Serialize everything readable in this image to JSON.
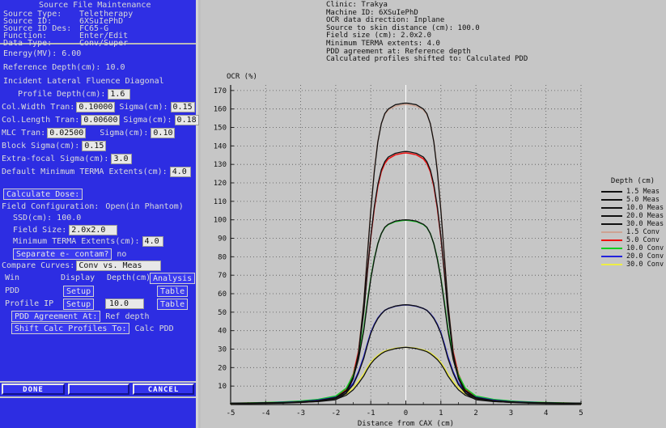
{
  "window": {
    "title": "Source File Maintenance",
    "header_fields": [
      {
        "label": "Source Type:",
        "value": "Teletherapy"
      },
      {
        "label": "Source ID:",
        "value": "6XSuIePhD"
      },
      {
        "label": "Source ID Des:",
        "value": "FC65-G"
      },
      {
        "label": "Function:",
        "value": "Enter/Edit"
      },
      {
        "label": "Data Type:",
        "value": "Conv/Super"
      }
    ]
  },
  "form": {
    "energy_label": "Energy(MV): 6.00",
    "reference_depth_label": "Reference Depth(cm): 10.0",
    "section_title": "Incident Lateral Fluence Diagonal",
    "profile_depth_label": "Profile Depth(cm):",
    "profile_depth_value": "1.6",
    "col_width_label": "Col.Width Tran:",
    "col_width_value": "0.10000",
    "col_width_sigma_label": "Sigma(cm):",
    "col_width_sigma_value": "0.15",
    "col_length_label": "Col.Length Tran:",
    "col_length_value": "0.00600",
    "col_length_sigma_label": "Sigma(cm):",
    "col_length_sigma_value": "0.18",
    "mlc_label": "MLC Tran:",
    "mlc_value": "0.02500",
    "mlc_sigma_label": "Sigma(cm):",
    "mlc_sigma_value": "0.10",
    "block_sigma_label": "Block Sigma(cm):",
    "block_sigma_value": "0.15",
    "extra_focal_label": "Extra-focal Sigma(cm):",
    "extra_focal_value": "3.0",
    "default_terma_label": "Default Minimum TERMA Extents(cm):",
    "default_terma_value": "4.0",
    "calculate_dose_button": "Calculate Dose:",
    "field_config_label": "Field Configuration:",
    "field_config_value": "Open(in Phantom)",
    "ssd_label": "SSD(cm): 100.0",
    "field_size_label": "Field Size:",
    "field_size_value": "2.0x2.0",
    "min_terma_label": "Minimum TERMA Extents(cm):",
    "min_terma_value": "4.0",
    "separate_contam_button": "Separate e- contam?",
    "separate_contam_value": "no",
    "compare_curves_label": "Compare Curves:",
    "compare_curves_value": "Conv vs. Meas",
    "table_headers": {
      "win": "Win",
      "display": "Display",
      "depth": "Depth(cm)",
      "analysis": "Analysis"
    },
    "rows": [
      {
        "win": "PDD",
        "setup": "Setup",
        "depth": "",
        "table": "Table"
      },
      {
        "win": "Profile IP",
        "setup": "Setup",
        "depth": "10.0",
        "table": "Table"
      }
    ],
    "pdd_agreement_button": "PDD Agreement At:",
    "pdd_agreement_value": "Ref depth",
    "shift_calc_button": "Shift Calc Profiles To:",
    "shift_calc_value": "Calc PDD"
  },
  "buttons": {
    "done": "DONE",
    "cancel": "CANCEL"
  },
  "plot_info": [
    "Clinic: Trakya",
    "Machine ID: 6XSuIePhD",
    "OCR data direction: Inplane",
    "Source to skin distance (cm): 100.0",
    "Field size (cm): 2.0x2.0",
    "Minimum TERMA extents: 4.0",
    "PDD agreement at: Reference depth",
    "Calculated profiles shifted to: Calculated PDD"
  ],
  "colors": {
    "meas": "#101010",
    "conv_1_5": "#cda393",
    "conv_5_0": "#ee1111",
    "conv_10_0": "#11cc22",
    "conv_20_0": "#2222dd",
    "conv_30_0": "#eeee44",
    "panel_bg": "#2d2de2",
    "chart_bg": "#c6c6c6"
  },
  "chart_data": {
    "type": "line",
    "title": "",
    "xlabel": "Distance from CAX (cm)",
    "ylabel": "OCR (%)",
    "xlim": [
      -5,
      5
    ],
    "ylim": [
      0,
      173
    ],
    "xticks": [
      -5,
      -4,
      -3,
      -2,
      -1,
      0,
      1,
      2,
      3,
      4,
      5
    ],
    "yticks": [
      10,
      20,
      30,
      40,
      50,
      60,
      70,
      80,
      90,
      100,
      110,
      120,
      130,
      140,
      150,
      160,
      170
    ],
    "grid": true,
    "legend_title": "Depth (cm)",
    "legend_position": "right",
    "x": [
      -5.0,
      -4.5,
      -4.0,
      -3.5,
      -3.0,
      -2.5,
      -2.0,
      -1.7,
      -1.5,
      -1.35,
      -1.2,
      -1.1,
      -1.0,
      -0.9,
      -0.8,
      -0.7,
      -0.6,
      -0.5,
      -0.3,
      -0.1,
      0.0,
      0.1,
      0.3,
      0.5,
      0.6,
      0.7,
      0.8,
      0.9,
      1.0,
      1.1,
      1.2,
      1.35,
      1.5,
      1.7,
      2.0,
      2.5,
      3.0,
      3.5,
      4.0,
      4.5,
      5.0
    ],
    "series": [
      {
        "name": "1.5 Meas",
        "color": "#101010",
        "depth": 1.5,
        "kind": "meas",
        "values": [
          0.7,
          0.8,
          0.9,
          1.0,
          1.2,
          1.6,
          2.6,
          6.0,
          14.0,
          28.0,
          55.0,
          80.0,
          105.0,
          126.0,
          142.0,
          152.0,
          157.5,
          160.0,
          162.3,
          163.0,
          163.2,
          163.0,
          162.3,
          160.0,
          157.5,
          152.0,
          142.0,
          126.0,
          105.0,
          80.0,
          55.0,
          28.0,
          14.0,
          6.0,
          2.6,
          1.6,
          1.2,
          1.0,
          0.9,
          0.8,
          0.7
        ]
      },
      {
        "name": "5.0 Meas",
        "color": "#101010",
        "depth": 5.0,
        "kind": "meas",
        "values": [
          0.7,
          0.8,
          0.9,
          1.1,
          1.4,
          2.0,
          3.4,
          7.2,
          15.0,
          27.0,
          50.0,
          71.0,
          91.0,
          107.0,
          119.0,
          127.0,
          131.5,
          134.0,
          136.0,
          136.8,
          137.0,
          136.8,
          136.0,
          134.0,
          131.5,
          127.0,
          119.0,
          107.0,
          91.0,
          71.0,
          50.0,
          27.0,
          15.0,
          7.2,
          3.4,
          2.0,
          1.4,
          1.1,
          0.9,
          0.8,
          0.7
        ]
      },
      {
        "name": "10.0 Meas",
        "color": "#101010",
        "depth": 10.0,
        "kind": "meas",
        "values": [
          0.6,
          0.7,
          0.9,
          1.1,
          1.5,
          2.2,
          3.8,
          7.6,
          14.5,
          24.5,
          40.0,
          54.5,
          68.0,
          78.5,
          87.0,
          92.5,
          96.0,
          97.6,
          99.3,
          99.9,
          100.0,
          99.9,
          99.3,
          97.6,
          96.0,
          92.5,
          87.0,
          78.5,
          68.0,
          54.5,
          40.0,
          24.5,
          14.5,
          7.6,
          3.8,
          2.2,
          1.5,
          1.1,
          0.9,
          0.7,
          0.6
        ]
      },
      {
        "name": "20.0 Meas",
        "color": "#101010",
        "depth": 20.0,
        "kind": "meas",
        "values": [
          0.5,
          0.6,
          0.7,
          0.9,
          1.3,
          2.0,
          3.4,
          6.2,
          10.8,
          17.0,
          25.0,
          32.0,
          38.5,
          43.0,
          46.5,
          49.0,
          51.0,
          52.0,
          53.3,
          53.9,
          54.0,
          53.9,
          53.3,
          52.0,
          51.0,
          49.0,
          46.5,
          43.0,
          38.5,
          32.0,
          25.0,
          17.0,
          10.8,
          6.2,
          3.4,
          2.0,
          1.3,
          0.9,
          0.7,
          0.6,
          0.5
        ]
      },
      {
        "name": "30.0 Meas",
        "color": "#101010",
        "depth": 30.0,
        "kind": "meas",
        "values": [
          0.4,
          0.5,
          0.6,
          0.8,
          1.1,
          1.7,
          2.8,
          5.0,
          8.0,
          11.5,
          15.5,
          19.0,
          22.0,
          24.3,
          26.0,
          27.5,
          28.6,
          29.3,
          30.3,
          30.8,
          31.0,
          30.8,
          30.3,
          29.3,
          28.6,
          27.5,
          26.0,
          24.3,
          22.0,
          19.0,
          15.5,
          11.5,
          8.0,
          5.0,
          2.8,
          1.7,
          1.1,
          0.8,
          0.6,
          0.5,
          0.4
        ]
      },
      {
        "name": "1.5 Conv",
        "color": "#cda393",
        "depth": 1.5,
        "kind": "conv",
        "values": [
          0.6,
          0.7,
          0.8,
          1.0,
          1.2,
          1.7,
          3.0,
          7.0,
          15.5,
          30.0,
          56.0,
          81.0,
          106.0,
          127.0,
          142.5,
          152.0,
          157.0,
          159.5,
          161.5,
          162.3,
          162.5,
          162.3,
          161.5,
          159.5,
          157.0,
          152.0,
          142.5,
          127.0,
          106.0,
          81.0,
          56.0,
          30.0,
          15.5,
          7.0,
          3.0,
          1.7,
          1.2,
          1.0,
          0.8,
          0.7,
          0.6
        ]
      },
      {
        "name": "5.0 Conv",
        "color": "#ee1111",
        "depth": 5.0,
        "kind": "conv",
        "values": [
          0.7,
          0.8,
          1.0,
          1.2,
          1.6,
          2.3,
          4.0,
          8.2,
          16.5,
          28.5,
          51.0,
          71.5,
          90.5,
          106.0,
          118.0,
          126.0,
          130.5,
          133.0,
          135.2,
          136.0,
          136.2,
          136.0,
          135.2,
          133.0,
          130.5,
          126.0,
          118.0,
          106.0,
          90.5,
          71.5,
          51.0,
          28.5,
          16.5,
          8.2,
          4.0,
          2.3,
          1.6,
          1.2,
          1.0,
          0.8,
          0.7
        ]
      },
      {
        "name": "10.0 Conv",
        "color": "#11cc22",
        "depth": 10.0,
        "kind": "conv",
        "values": [
          0.7,
          0.9,
          1.1,
          1.4,
          1.9,
          2.8,
          4.6,
          8.8,
          16.0,
          26.0,
          41.5,
          55.5,
          68.5,
          79.0,
          87.0,
          92.5,
          95.8,
          97.4,
          99.0,
          99.6,
          99.8,
          99.6,
          99.0,
          97.4,
          95.8,
          92.5,
          87.0,
          79.0,
          68.5,
          55.5,
          41.5,
          26.0,
          16.0,
          8.8,
          4.6,
          2.8,
          1.9,
          1.4,
          1.1,
          0.9,
          0.7
        ]
      },
      {
        "name": "20.0 Conv",
        "color": "#2222dd",
        "depth": 20.0,
        "kind": "conv",
        "values": [
          0.6,
          0.7,
          0.9,
          1.2,
          1.6,
          2.4,
          4.0,
          7.0,
          11.6,
          17.8,
          26.0,
          32.8,
          39.0,
          43.4,
          46.8,
          49.2,
          51.0,
          52.0,
          53.2,
          53.8,
          53.9,
          53.8,
          53.2,
          52.0,
          51.0,
          49.2,
          46.8,
          43.4,
          39.0,
          32.8,
          26.0,
          17.8,
          11.6,
          7.0,
          4.0,
          2.4,
          1.6,
          1.2,
          0.9,
          0.7,
          0.6
        ]
      },
      {
        "name": "30.0 Conv",
        "color": "#eeee44",
        "depth": 30.0,
        "kind": "conv",
        "values": [
          0.5,
          0.6,
          0.8,
          1.0,
          1.4,
          2.1,
          3.4,
          5.8,
          9.0,
          12.6,
          16.6,
          20.0,
          22.8,
          25.0,
          26.6,
          28.0,
          29.0,
          29.6,
          30.5,
          30.9,
          31.0,
          30.9,
          30.5,
          29.6,
          29.0,
          28.0,
          26.6,
          25.0,
          22.8,
          20.0,
          16.6,
          12.6,
          9.0,
          5.8,
          3.4,
          2.1,
          1.4,
          1.0,
          0.8,
          0.6,
          0.5
        ]
      }
    ],
    "legend": [
      {
        "label": "1.5 Meas",
        "color": "#101010"
      },
      {
        "label": "5.0 Meas",
        "color": "#101010"
      },
      {
        "label": "10.0 Meas",
        "color": "#101010"
      },
      {
        "label": "20.0 Meas",
        "color": "#101010"
      },
      {
        "label": "30.0 Meas",
        "color": "#101010"
      },
      {
        "label": "1.5 Conv",
        "color": "#cda393"
      },
      {
        "label": "5.0 Conv",
        "color": "#ee1111"
      },
      {
        "label": "10.0 Conv",
        "color": "#11cc22"
      },
      {
        "label": "20.0 Conv",
        "color": "#2222dd"
      },
      {
        "label": "30.0 Conv",
        "color": "#eeee44"
      }
    ]
  }
}
